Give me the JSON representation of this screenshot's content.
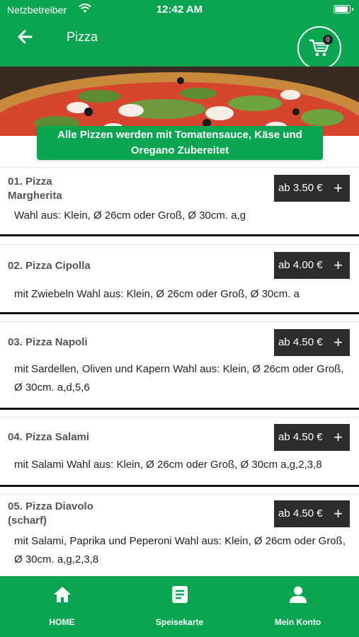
{
  "status_bar": {
    "carrier": "Netzbetreiber",
    "time": "12:42 AM"
  },
  "header": {
    "title": "Pizza",
    "cart_count": "0"
  },
  "notice": "Alle Pizzen werden mit Tomatensauce, Käse und Oregano Zubereitet",
  "menu_items": [
    {
      "name": "01. Pizza Margherita",
      "price": "ab 3.50 €",
      "description": "Wahl aus: Klein, Ø 26cm oder Groß, Ø 30cm. a,g"
    },
    {
      "name": "02. Pizza Cipolla",
      "price": "ab 4.00 €",
      "description": "mit Zwiebeln Wahl aus: Klein, Ø 26cm oder Groß, Ø 30cm. a"
    },
    {
      "name": "03. Pizza Napoli",
      "price": "ab 4.50 €",
      "description": "mit Sardellen, Oliven und Kapern Wahl aus: Klein, Ø 26cm oder Groß, Ø 30cm. a,d,5,6"
    },
    {
      "name": "04. Pizza Salami",
      "price": "ab 4.50 €",
      "description": "mit Salami Wahl aus: Klein, Ø 26cm oder Groß, Ø 30cm a,g,2,3,8"
    },
    {
      "name": "05. Pizza Diavolo (scharf)",
      "price": "ab 4.50 €",
      "description": "mit Salami, Paprika und Peperoni Wahl aus: Klein, Ø 26cm oder Groß, Ø 30cm. a,g,2,3,8"
    }
  ],
  "price_plus": "+",
  "bottom_nav": [
    {
      "label": "HOME",
      "icon": "home-icon"
    },
    {
      "label": "Speisekarte",
      "icon": "menu-card-icon"
    },
    {
      "label": "Mein Konto",
      "icon": "account-icon"
    }
  ],
  "colors": {
    "brand_green": "#0aa551",
    "price_button": "#2c2c2c"
  }
}
